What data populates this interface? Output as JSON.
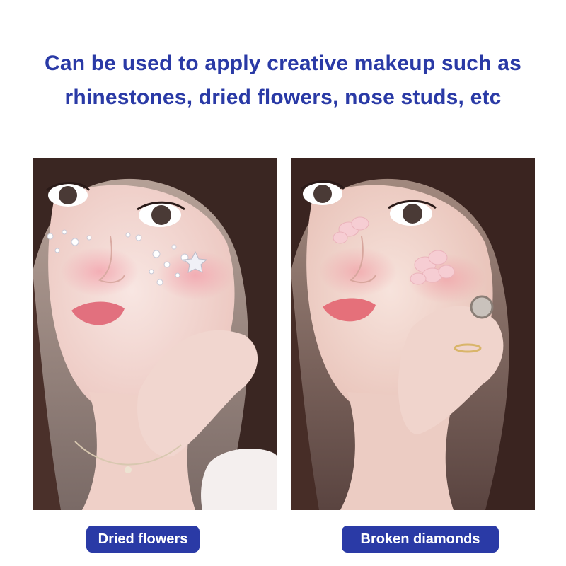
{
  "headline": {
    "line1": "Can be used to apply creative makeup such as",
    "line2": "rhinestones, dried flowers, nose studs, etc"
  },
  "colors": {
    "accent": "#2a3aa6",
    "label_text": "#ffffff"
  },
  "panels": [
    {
      "label": "Dried flowers",
      "icon": "rhinestone-face-photo"
    },
    {
      "label": "Broken diamonds",
      "icon": "petal-face-photo"
    }
  ]
}
